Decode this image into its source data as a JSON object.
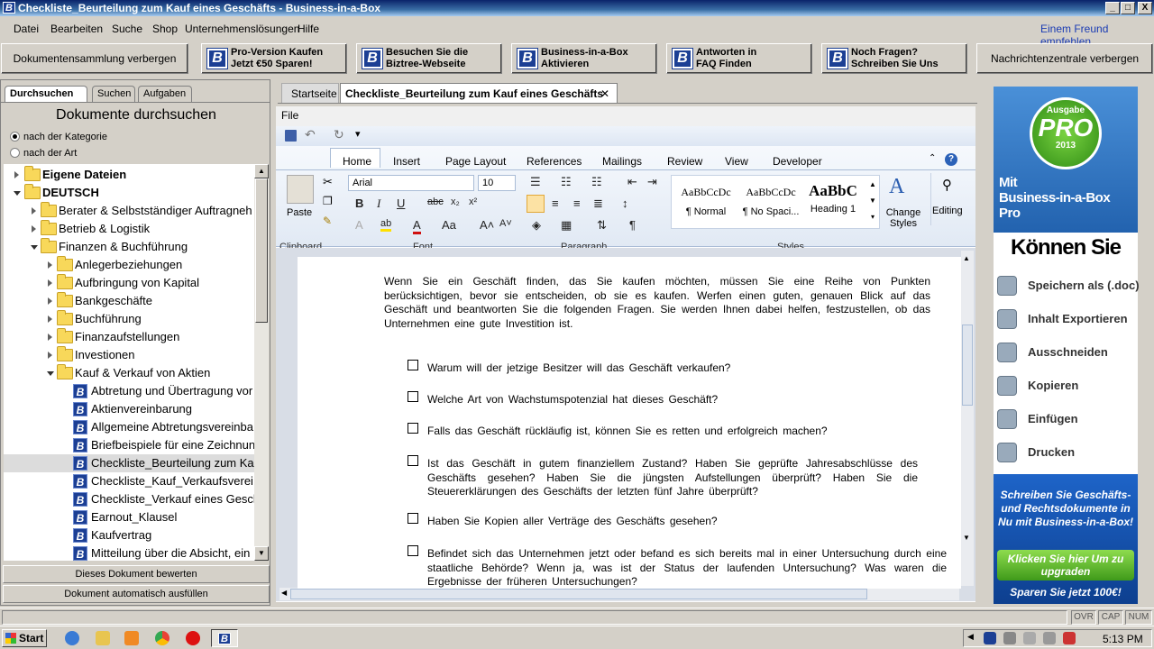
{
  "window": {
    "title": "Checkliste_Beurteilung zum Kauf eines Geschäfts - Business-in-a-Box",
    "min": "_",
    "max": "□",
    "close": "X",
    "applogo": "B"
  },
  "menu": {
    "items": [
      "Datei",
      "Bearbeiten",
      "Suche",
      "Shop",
      "Unternehmenslösungen",
      "Hilfe"
    ],
    "link": "Einem Freund empfehlen"
  },
  "toolbar": {
    "hide_docs": "Dokumentensammlung verbergen",
    "buttons": [
      {
        "l1": "Pro-Version Kaufen",
        "l2": "Jetzt €50 Sparen!"
      },
      {
        "l1": "Besuchen Sie die",
        "l2": "Biztree-Webseite"
      },
      {
        "l1": "Business-in-a-Box",
        "l2": "Aktivieren"
      },
      {
        "l1": "Antworten in",
        "l2": "FAQ Finden"
      },
      {
        "l1": "Noch Fragen?",
        "l2": "Schreiben Sie Uns"
      }
    ],
    "hide_news": "Nachrichtenzentrale verbergen"
  },
  "left": {
    "tabs": [
      "Durchsuchen",
      "Suchen",
      "Aufgaben"
    ],
    "title": "Dokumente durchsuchen",
    "radio1": "nach der Kategorie",
    "radio2": "nach der Art",
    "tree": [
      "Eigene Dateien",
      "DEUTSCH",
      "Berater & Selbstständiger Auftragneh",
      "Betrieb & Logistik",
      "Finanzen & Buchführung",
      "Anlegerbeziehungen",
      "Aufbringung von Kapital",
      "Bankgeschäfte",
      "Buchführung",
      "Finanzaufstellungen",
      "Investionen",
      "Kauf & Verkauf von Aktien",
      "Abtretung und Übertragung vor",
      "Aktienvereinbarung",
      "Allgemeine Abtretungsvereinba",
      "Briefbeispiele für eine Zeichnun",
      "Checkliste_Beurteilung zum Kau",
      "Checkliste_Kauf_Verkaufsverei",
      "Checkliste_Verkauf eines Gesch",
      "Earnout_Klausel",
      "Kaufvertrag",
      "Mitteilung über die Absicht, ein"
    ],
    "btn_rate": "Dieses Dokument bewerten",
    "btn_fill": "Dokument automatisch ausfüllen"
  },
  "doc_tabs": {
    "home": "Startseite",
    "active": "Checkliste_Beurteilung zum Kauf eines Geschäfts",
    "close": "✕"
  },
  "word": {
    "file": "File",
    "tabs": [
      "Home",
      "Insert",
      "Page Layout",
      "References",
      "Mailings",
      "Review",
      "View",
      "Developer"
    ],
    "font": "Arial",
    "size": "10",
    "paste": "Paste",
    "groups": [
      "Clipboard",
      "Font",
      "Paragraph",
      "Styles"
    ],
    "styles": [
      {
        "sample": "AaBbCcDc",
        "name": "¶ Normal"
      },
      {
        "sample": "AaBbCcDc",
        "name": "¶ No Spaci..."
      },
      {
        "sample": "AaBbC",
        "name": "Heading 1"
      }
    ],
    "change_styles": "Change Styles",
    "editing": "Editing"
  },
  "content": {
    "intro": "Wenn Sie ein Geschäft finden, das Sie kaufen möchten, müssen Sie eine Reihe von Punkten berücksichtigen, bevor sie entscheiden, ob sie es kaufen. Werfen einen guten, genauen Blick auf das Geschäft und beantworten Sie die folgenden Fragen. Sie werden Ihnen dabei helfen, festzustellen, ob das Unternehmen eine gute Investition ist.",
    "items": [
      "Warum will der jetzige Besitzer will das Geschäft verkaufen?",
      "Welche Art von Wachstumspotenzial hat dieses Geschäft?",
      "Falls das Geschäft rückläufig ist, können Sie es retten und erfolgreich machen?",
      "Ist das Geschäft in gutem finanziellem Zustand? Haben Sie geprüfte Jahresabschlüsse des Geschäfts gesehen? Haben Sie die jüngsten Aufstellungen überprüft? Haben Sie die Steuererklärungen des Geschäfts der letzten fünf Jahre überprüft?",
      "Haben Sie Kopien aller Verträge des Geschäfts gesehen?",
      "Befindet sich das Unternehmen jetzt oder befand es sich bereits mal in einer Untersuchung durch eine staatliche Behörde? Wenn ja, was ist der Status der laufenden Untersuchung? Was waren die Ergebnisse der früheren Untersuchungen?"
    ]
  },
  "ad": {
    "badge_top": "Ausgabe",
    "badge": "PRO",
    "year": "2013",
    "mit": "Mit",
    "brand": "Business-in-a-Box",
    "pro": "Pro",
    "koennen": "Können Sie",
    "actions": [
      "Speichern als (.doc)",
      "Inhalt Exportieren",
      "Ausschneiden",
      "Kopieren",
      "Einfügen",
      "Drucken"
    ],
    "bottom": "Schreiben Sie Geschäfts-und Rechtsdokumente in Nu mit Business-in-a-Box!",
    "cta": "Klicken Sie hier Um zu upgraden",
    "save": "Sparen Sie jetzt 100€!"
  },
  "status": {
    "ovr": "OVR",
    "cap": "CAP",
    "num": "NUM"
  },
  "taskbar": {
    "start": "Start",
    "time": "5:13 PM"
  }
}
